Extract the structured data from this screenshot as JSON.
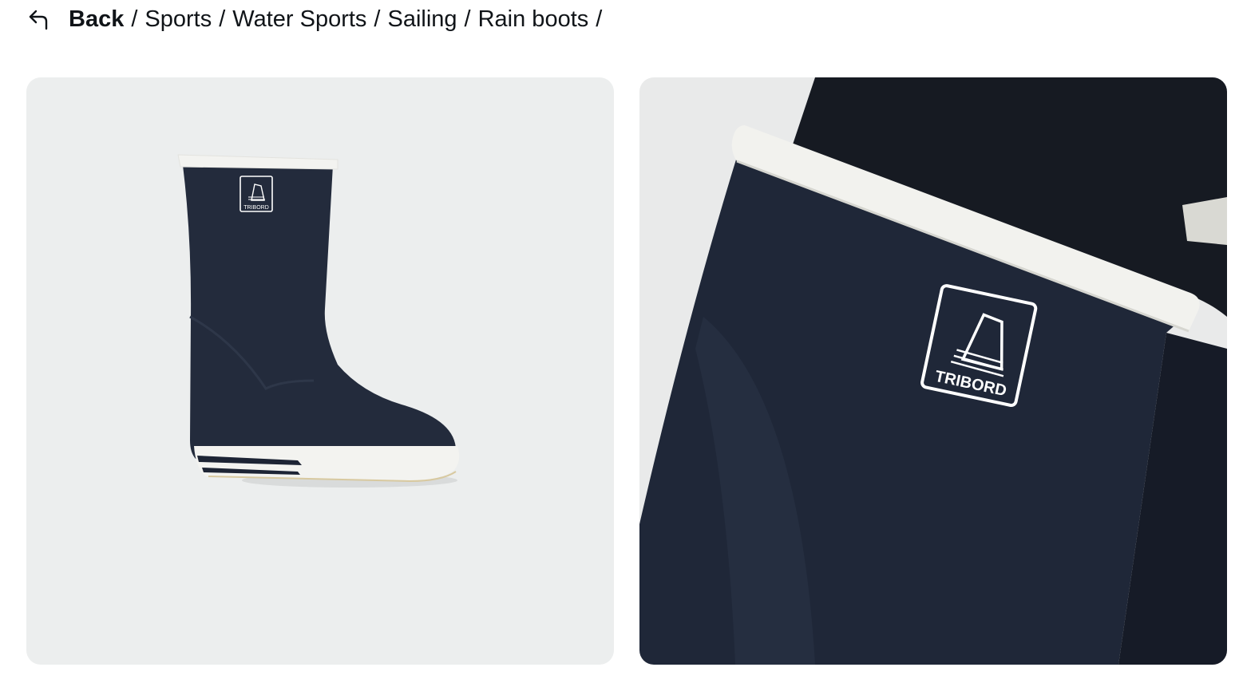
{
  "breadcrumb": {
    "back_label": "Back",
    "items": [
      "Sports",
      "Water Sports",
      "Sailing",
      "Rain boots"
    ],
    "separator": "/"
  },
  "gallery": {
    "images": [
      {
        "view": "side view",
        "brand_mark": "TRIBORD"
      },
      {
        "view": "close-up of cuff",
        "brand_mark": "TRIBORD"
      }
    ]
  },
  "colors": {
    "boot_navy": "#1f2738",
    "cuff_white": "#f2f2ee",
    "panel_bg": "#eceeee"
  }
}
